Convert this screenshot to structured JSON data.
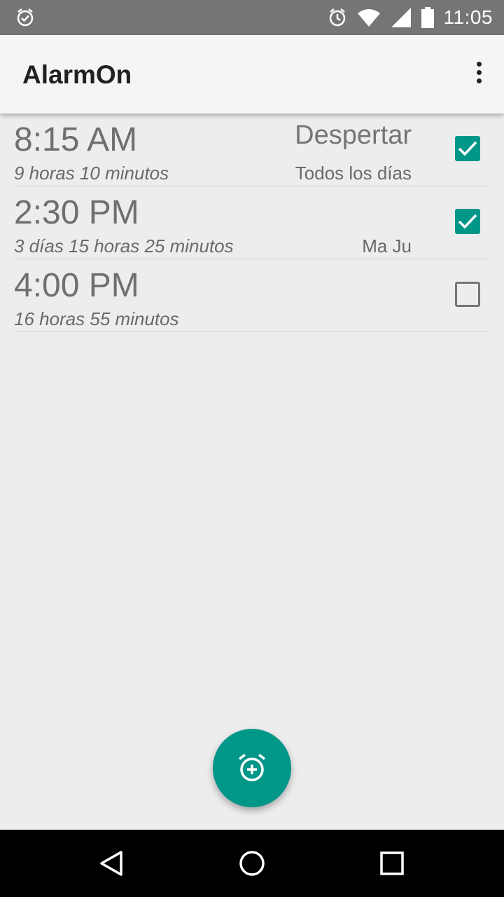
{
  "status_bar": {
    "time": "11:05",
    "icons": [
      "alarm-icon",
      "alarm-clock-icon",
      "wifi-icon",
      "signal-icon",
      "battery-icon"
    ]
  },
  "app_bar": {
    "title": "AlarmOn",
    "menu_icon": "overflow-menu-icon"
  },
  "alarms": [
    {
      "time": "8:15 AM",
      "remaining": "9 horas 10 minutos",
      "label": "Despertar",
      "days": "Todos los días",
      "enabled": true
    },
    {
      "time": "2:30 PM",
      "remaining": "3 días 15 horas 25 minutos",
      "label": "",
      "days": "Ma Ju",
      "enabled": true
    },
    {
      "time": "4:00 PM",
      "remaining": "16 horas 55 minutos",
      "label": "",
      "days": "",
      "enabled": false
    }
  ],
  "fab": {
    "icon": "add-alarm-icon"
  },
  "nav_bar": {
    "icons": [
      "back-icon",
      "home-icon",
      "recents-icon"
    ]
  },
  "colors": {
    "accent": "#009688",
    "status_bar": "#757575",
    "app_bar": "#f5f5f5",
    "background": "#ededed"
  }
}
